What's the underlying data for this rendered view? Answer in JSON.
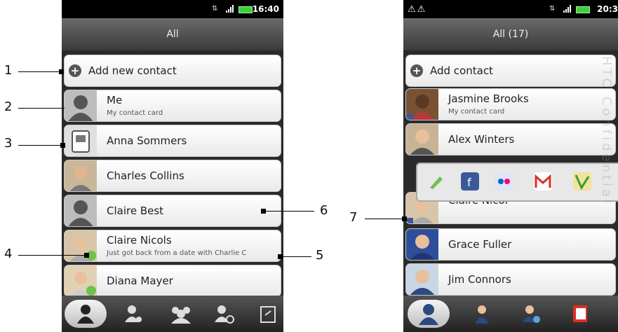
{
  "left_screen": {
    "status_time": "16:40",
    "title": "All",
    "rows": [
      {
        "kind": "add",
        "label": "Add new contact"
      },
      {
        "kind": "me",
        "name": "Me",
        "sub": "My contact card"
      },
      {
        "kind": "sim",
        "name": "Anna Sommers"
      },
      {
        "kind": "photo",
        "name": "Charles Collins"
      },
      {
        "kind": "placeholder",
        "name": "Claire Best"
      },
      {
        "kind": "photo",
        "name": "Claire Nicols",
        "sub": "Just got back from a date with Charlie C"
      },
      {
        "kind": "photo",
        "name": "Diana Mayer"
      }
    ],
    "tabs": [
      "person-icon",
      "person-check-icon",
      "group-icon",
      "call-history-icon",
      "sync-icon"
    ]
  },
  "right_screen": {
    "status_time": "20:3",
    "title": "All (17)",
    "rows": [
      {
        "kind": "add",
        "label": "Add contact"
      },
      {
        "kind": "photo",
        "name": "Jasmine Brooks",
        "sub": "My contact card"
      },
      {
        "kind": "photo",
        "name": "Alex Winters"
      },
      {
        "kind": "photo",
        "name": "Claire Nicol"
      },
      {
        "kind": "photo",
        "name": "Grace Fuller"
      },
      {
        "kind": "photo",
        "name": "Jim Connors"
      }
    ],
    "quickbar": [
      "edit-icon",
      "facebook-icon",
      "flickr-icon",
      "gmail-icon",
      "maps-icon"
    ],
    "watermark": "HTC Confidential"
  },
  "callouts": [
    "1",
    "2",
    "3",
    "4",
    "5",
    "6",
    "7"
  ],
  "colors": {
    "title_bg": "#4d4d4d",
    "row_bg": "#f3f3f3",
    "accent_green": "#6cc24a"
  }
}
